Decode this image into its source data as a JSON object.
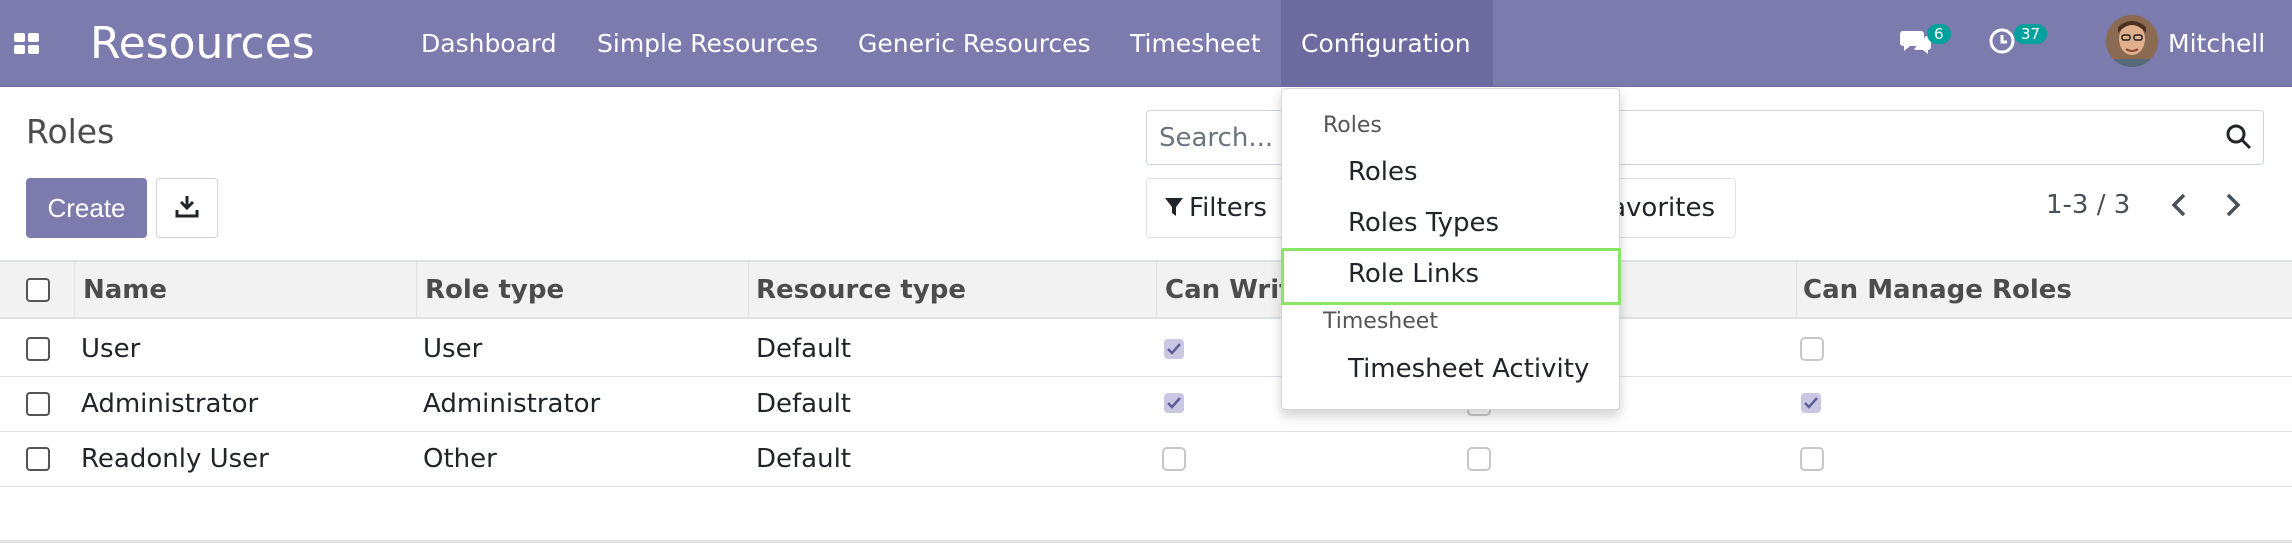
{
  "navbar": {
    "app_title": "Resources",
    "menu": [
      "Dashboard",
      "Simple Resources",
      "Generic Resources",
      "Timesheet",
      "Configuration"
    ],
    "messages_count": "6",
    "activities_count": "37",
    "user_name": "Mitchell"
  },
  "control_panel": {
    "title": "Roles",
    "create_label": "Create",
    "search_placeholder": "Search...",
    "filters_label": "Filters",
    "favorites_label": "Favorites",
    "pager": "1-3 / 3"
  },
  "table": {
    "columns": [
      "Name",
      "Role type",
      "Resource type",
      "Can Write",
      "Can Manage Roles"
    ],
    "rows": [
      {
        "name": "User",
        "role_type": "User",
        "resource_type": "Default",
        "can_write": true,
        "hidden_col": false,
        "can_manage_roles": false
      },
      {
        "name": "Administrator",
        "role_type": "Administrator",
        "resource_type": "Default",
        "can_write": true,
        "hidden_col": true,
        "can_manage_roles": true
      },
      {
        "name": "Readonly User",
        "role_type": "Other",
        "resource_type": "Default",
        "can_write": false,
        "hidden_col": false,
        "can_manage_roles": false
      }
    ]
  },
  "dropdown": {
    "sections": [
      {
        "header": "Roles",
        "items": [
          "Roles",
          "Roles Types",
          "Role Links"
        ]
      },
      {
        "header": "Timesheet",
        "items": [
          "Timesheet Activity"
        ]
      }
    ],
    "highlighted_item": "Role Links"
  },
  "colors": {
    "navbar": "#7c7bad",
    "highlight": "#8be565",
    "badge": "#00a09d"
  }
}
